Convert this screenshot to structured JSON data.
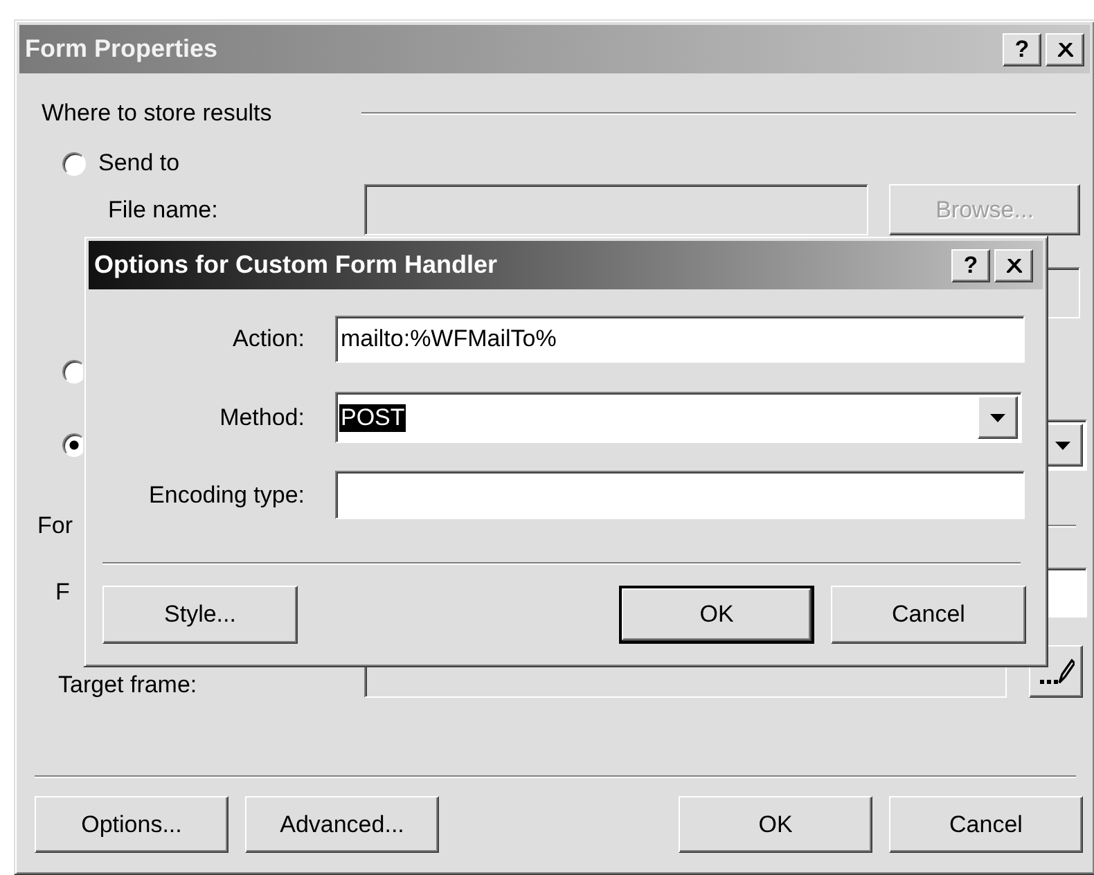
{
  "main_window": {
    "title": "Form Properties",
    "help_button": "?",
    "store_group": {
      "title": "Where to store results",
      "options": [
        {
          "label": "Send to",
          "selected": false
        },
        {
          "selected": false
        },
        {
          "selected": true
        }
      ],
      "file_name": {
        "label": "File name:",
        "disabled": true
      },
      "browse_button": {
        "label": "Browse...",
        "disabled": true
      }
    },
    "form_group": {
      "title": "For"
    },
    "form_name": {
      "label": "F"
    },
    "target_frame": {
      "label": "Target frame:",
      "disabled": true
    },
    "buttons": [
      {
        "label": "Options..."
      },
      {
        "label": "Advanced..."
      },
      {
        "label": "OK"
      },
      {
        "label": "Cancel"
      }
    ]
  },
  "handler_dialog": {
    "title": "Options for Custom Form Handler",
    "help_button": "?",
    "action": {
      "label": "Action:",
      "value": "mailto:%WFMailTo%"
    },
    "method": {
      "label": "Method:",
      "value": "POST",
      "selected": true
    },
    "encoding": {
      "label": "Encoding type:"
    },
    "buttons": [
      {
        "label": "Style...",
        "default": false
      },
      {
        "label": "OK",
        "default": true
      },
      {
        "label": "Cancel",
        "default": false
      }
    ]
  }
}
